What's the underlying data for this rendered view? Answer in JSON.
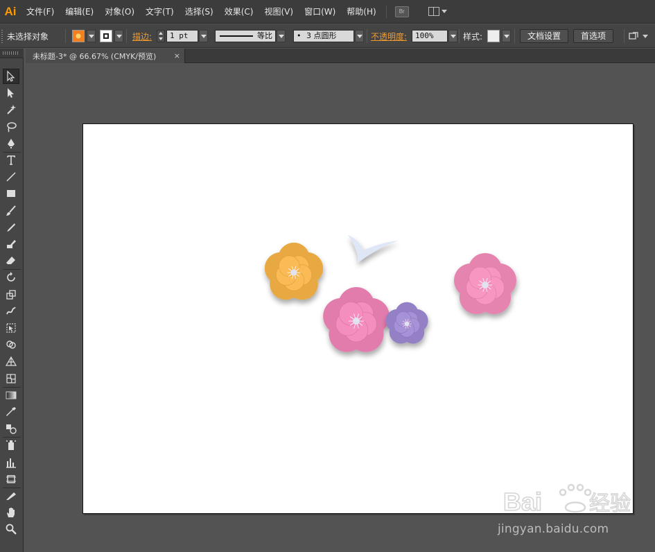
{
  "app": {
    "logo": "Ai",
    "accent": "#ff9a00"
  },
  "menu": [
    "文件(F)",
    "编辑(E)",
    "对象(O)",
    "文字(T)",
    "选择(S)",
    "效果(C)",
    "视图(V)",
    "窗口(W)",
    "帮助(H)"
  ],
  "bridge_label": "Br",
  "control": {
    "selection_status": "未选择对象",
    "fill_color": "#f08020",
    "stroke_label": "描边:",
    "stroke_weight": "1 pt",
    "stroke_profile": "等比",
    "brush": "3 点圆形",
    "brush_dot": "•",
    "opacity_label": "不透明度:",
    "opacity_value": "100%",
    "style_label": "样式:",
    "doc_setup": "文档设置",
    "preferences": "首选项"
  },
  "document_tab": {
    "title": "未标题-3* @ 66.67% (CMYK/预览)",
    "close": "×"
  },
  "tools": [
    "selection-tool",
    "direct-selection-tool",
    "magic-wand-tool",
    "lasso-tool",
    "pen-tool",
    "type-tool",
    "line-segment-tool",
    "rectangle-tool",
    "paintbrush-tool",
    "pencil-tool",
    "blob-brush-tool",
    "eraser-tool",
    "rotate-tool",
    "scale-tool",
    "warp-tool",
    "free-transform-tool",
    "shape-builder-tool",
    "perspective-grid-tool",
    "mesh-tool",
    "gradient-tool",
    "eyedropper-tool",
    "blend-tool",
    "symbol-sprayer-tool",
    "column-graph-tool",
    "artboard-tool",
    "slice-tool",
    "hand-tool",
    "zoom-tool"
  ],
  "artwork": {
    "flowers": [
      {
        "name": "orange-flower",
        "color": "#f0b04a",
        "center": "#ffffff"
      },
      {
        "name": "pink-flower-large",
        "color": "#ea84b4",
        "center": "#ffffff"
      },
      {
        "name": "purple-flower",
        "color": "#9c88cc",
        "center": "#ffd8e6"
      },
      {
        "name": "pink-flower-right",
        "color": "#ee8cb8",
        "center": "#ffffff"
      }
    ],
    "bird_color": "#dfe6f5"
  },
  "watermark": {
    "logo": "Baidu经验",
    "url": "jingyan.baidu.com"
  }
}
